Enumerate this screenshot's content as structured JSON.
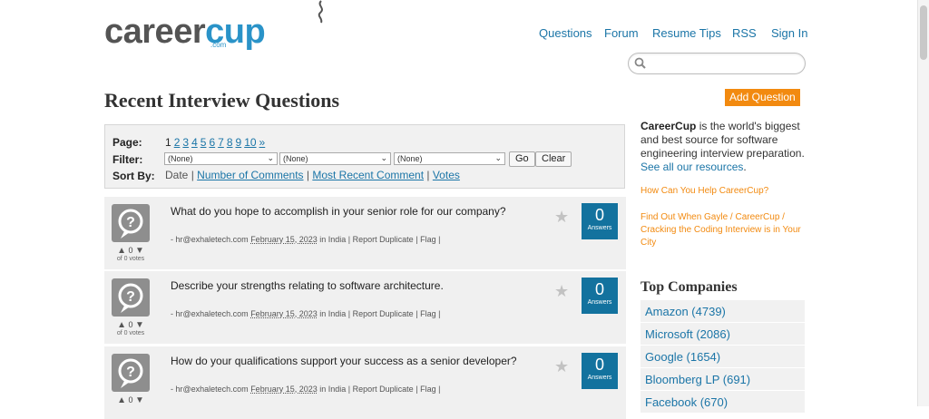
{
  "logo": {
    "word_part1": "career",
    "word_part2": "cup",
    "dotcom": ".com"
  },
  "nav": [
    "Questions",
    "Forum",
    "Resume Tips",
    "RSS",
    "Sign In"
  ],
  "search": {
    "placeholder": ""
  },
  "page_title": "Recent Interview Questions",
  "controls": {
    "page_label": "Page:",
    "pages": [
      "1",
      "2",
      "3",
      "4",
      "5",
      "6",
      "7",
      "8",
      "9",
      "10",
      "»"
    ],
    "filter_label": "Filter:",
    "filters": [
      "(None)",
      "(None)",
      "(None)"
    ],
    "go_label": "Go",
    "clear_label": "Clear",
    "sortby_label": "Sort By:",
    "sort_date": "Date",
    "sort_comments": "Number of Comments",
    "sort_recent": "Most Recent Comment",
    "sort_votes": "Votes"
  },
  "questions": [
    {
      "text": "What do you hope to accomplish in your senior role for our company?",
      "author": "- hr@exhaletech.com",
      "date": "February 15, 2023",
      "location": "in India",
      "report": "Report Duplicate",
      "flag": "Flag",
      "votes": "0",
      "of_votes": "of 0 votes",
      "answers": "0",
      "answers_label": "Answers"
    },
    {
      "text": "Describe your strengths relating to software architecture.",
      "author": "- hr@exhaletech.com",
      "date": "February 15, 2023",
      "location": "in India",
      "report": "Report Duplicate",
      "flag": "Flag",
      "votes": "0",
      "of_votes": "of 0 votes",
      "answers": "0",
      "answers_label": "Answers"
    },
    {
      "text": "How do your qualifications support your success as a senior developer?",
      "author": "- hr@exhaletech.com",
      "date": "February 15, 2023",
      "location": "in India",
      "report": "Report Duplicate",
      "flag": "Flag",
      "votes": "0",
      "of_votes": "",
      "answers": "0",
      "answers_label": "Answers"
    }
  ],
  "sidebar": {
    "add_question": "Add Question",
    "brand": "CareerCup",
    "blurb": " is the world's biggest and best source for software engineering interview preparation.",
    "resources": "See all our resources",
    "resources_tail": ".",
    "help_link": "How Can You Help CareerCup?",
    "gayle_link": "Find Out When Gayle / CareerCup / Cracking the Coding Interview is in Your City",
    "top_companies_title": "Top Companies",
    "companies": [
      "Amazon (4739)",
      "Microsoft (2086)",
      "Google (1654)",
      "Bloomberg LP (691)",
      "Facebook (670)"
    ]
  },
  "colors": {
    "link": "#1b75a7",
    "accent": "#f28a10",
    "answers_bg": "#13729e",
    "row_bg": "#f0f0f0"
  }
}
